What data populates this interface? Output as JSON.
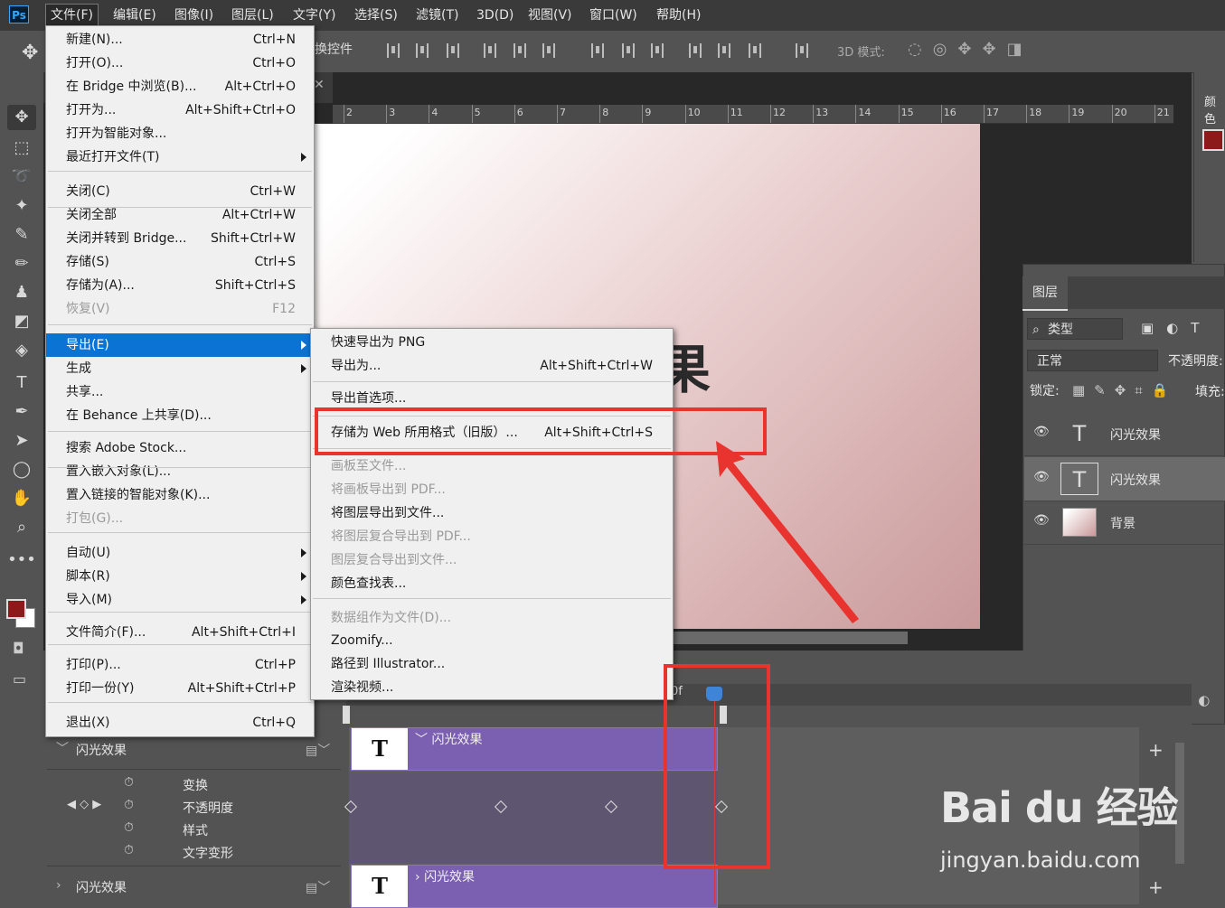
{
  "menubar": {
    "logo": "Ps",
    "items": [
      "文件(F)",
      "编辑(E)",
      "图像(I)",
      "图层(L)",
      "文字(Y)",
      "选择(S)",
      "滤镜(T)",
      "3D(D)",
      "视图(V)",
      "窗口(W)",
      "帮助(H)"
    ]
  },
  "optionsbar": {
    "transform_text": "换控件",
    "mode_3d": "3D 模式:"
  },
  "ruler": {
    "numbers": [
      "2",
      "3",
      "4",
      "5",
      "6",
      "7",
      "8",
      "9",
      "10",
      "11",
      "12",
      "13",
      "14",
      "15",
      "16",
      "17",
      "18",
      "19",
      "20",
      "21"
    ]
  },
  "canvas": {
    "text": "果"
  },
  "file_menu": {
    "items": [
      {
        "label": "新建(N)...",
        "shortcut": "Ctrl+N"
      },
      {
        "label": "打开(O)...",
        "shortcut": "Ctrl+O"
      },
      {
        "label": "在 Bridge 中浏览(B)...",
        "shortcut": "Alt+Ctrl+O"
      },
      {
        "label": "打开为...",
        "shortcut": "Alt+Shift+Ctrl+O"
      },
      {
        "label": "打开为智能对象...",
        "shortcut": ""
      },
      {
        "label": "最近打开文件(T)",
        "shortcut": ""
      },
      {
        "label": "关闭(C)",
        "shortcut": "Ctrl+W"
      },
      {
        "label": "关闭全部",
        "shortcut": "Alt+Ctrl+W"
      },
      {
        "label": "关闭并转到 Bridge...",
        "shortcut": "Shift+Ctrl+W"
      },
      {
        "label": "存储(S)",
        "shortcut": "Ctrl+S"
      },
      {
        "label": "存储为(A)...",
        "shortcut": "Shift+Ctrl+S"
      },
      {
        "label": "恢复(V)",
        "shortcut": "F12"
      },
      {
        "label": "导出(E)",
        "shortcut": ""
      },
      {
        "label": "生成",
        "shortcut": ""
      },
      {
        "label": "共享...",
        "shortcut": ""
      },
      {
        "label": "在 Behance 上共享(D)...",
        "shortcut": ""
      },
      {
        "label": "搜索 Adobe Stock...",
        "shortcut": ""
      },
      {
        "label": "置入嵌入对象(L)...",
        "shortcut": ""
      },
      {
        "label": "置入链接的智能对象(K)...",
        "shortcut": ""
      },
      {
        "label": "打包(G)...",
        "shortcut": ""
      },
      {
        "label": "自动(U)",
        "shortcut": ""
      },
      {
        "label": "脚本(R)",
        "shortcut": ""
      },
      {
        "label": "导入(M)",
        "shortcut": ""
      },
      {
        "label": "文件简介(F)...",
        "shortcut": "Alt+Shift+Ctrl+I"
      },
      {
        "label": "打印(P)...",
        "shortcut": "Ctrl+P"
      },
      {
        "label": "打印一份(Y)",
        "shortcut": "Alt+Shift+Ctrl+P"
      },
      {
        "label": "退出(X)",
        "shortcut": "Ctrl+Q"
      }
    ]
  },
  "export_menu": {
    "items": [
      {
        "label": "快速导出为 PNG",
        "shortcut": ""
      },
      {
        "label": "导出为...",
        "shortcut": "Alt+Shift+Ctrl+W"
      },
      {
        "label": "导出首选项...",
        "shortcut": ""
      },
      {
        "label": "存储为 Web 所用格式（旧版）...",
        "shortcut": "Alt+Shift+Ctrl+S"
      },
      {
        "label": "画板至文件...",
        "shortcut": ""
      },
      {
        "label": "将画板导出到 PDF...",
        "shortcut": ""
      },
      {
        "label": "将图层导出到文件...",
        "shortcut": ""
      },
      {
        "label": "将图层复合导出到 PDF...",
        "shortcut": ""
      },
      {
        "label": "图层复合导出到文件...",
        "shortcut": ""
      },
      {
        "label": "颜色查找表...",
        "shortcut": ""
      },
      {
        "label": "数据组作为文件(D)...",
        "shortcut": ""
      },
      {
        "label": "Zoomify...",
        "shortcut": ""
      },
      {
        "label": "路径到 Illustrator...",
        "shortcut": ""
      },
      {
        "label": "渲染视频...",
        "shortcut": ""
      }
    ]
  },
  "color_panel": {
    "title": "颜色",
    "fg": "#8c1a1a"
  },
  "layers_panel": {
    "tab": "图层",
    "filter": "类型",
    "blend": "正常",
    "opacity_label": "不透明度:",
    "lock_label": "锁定:",
    "fill_label": "填充:",
    "layers": [
      {
        "name": "闪光效果",
        "type": "text"
      },
      {
        "name": "闪光效果",
        "type": "text"
      },
      {
        "name": "背景",
        "type": "image"
      }
    ]
  },
  "timeline": {
    "frame_label": "0f",
    "layer1": "闪光效果",
    "props": [
      "变换",
      "不透明度",
      "样式",
      "文字变形"
    ],
    "layer2": "闪光效果",
    "clip_label1": "闪光效果",
    "clip_label2": "闪光效果",
    "clip_thumb": "T"
  },
  "watermark": {
    "logo": "Bai du 经验",
    "url": "jingyan.baidu.com"
  },
  "colors": {
    "accent": "#0b73d4",
    "annotation": "#e8332f",
    "clip": "#7b5fb0"
  }
}
